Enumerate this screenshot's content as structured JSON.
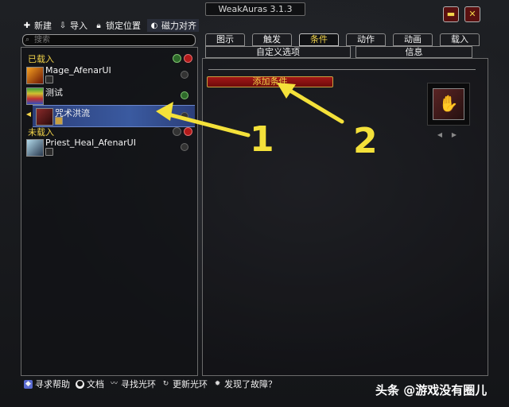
{
  "window": {
    "title": "WeakAuras 3.1.3"
  },
  "toolbar": {
    "new_label": "新建",
    "import_label": "导入",
    "lock_label": "锁定位置",
    "magnet_label": "磁力对齐"
  },
  "search": {
    "placeholder": "搜索"
  },
  "left": {
    "loaded_header": "已载入",
    "unloaded_header": "未载入",
    "auras": [
      {
        "label": "Mage_AfenarUI"
      },
      {
        "label": "测试"
      },
      {
        "label": "咒术洪流"
      },
      {
        "label": "Priest_Heal_AfenarUI"
      }
    ]
  },
  "tabs": [
    {
      "label": "图示"
    },
    {
      "label": "触发"
    },
    {
      "label": "条件",
      "active": true
    },
    {
      "label": "动作"
    },
    {
      "label": "动画"
    },
    {
      "label": "载入"
    }
  ],
  "subtabs": [
    {
      "label": "自定义选项"
    },
    {
      "label": "信息"
    }
  ],
  "main": {
    "add_condition_label": "添加条件"
  },
  "footer": {
    "help_label": "寻求帮助",
    "docs_label": "文档",
    "find_label": "寻找光环",
    "update_label": "更新光环",
    "bug_label": "发现了故障？"
  },
  "watermark": "头条 @游戏没有圈儿",
  "annotations": {
    "one": "1",
    "two": "2"
  },
  "colors": {
    "accent": "#f4d54a",
    "annotation": "#f4e13a",
    "button": "#a21616"
  }
}
